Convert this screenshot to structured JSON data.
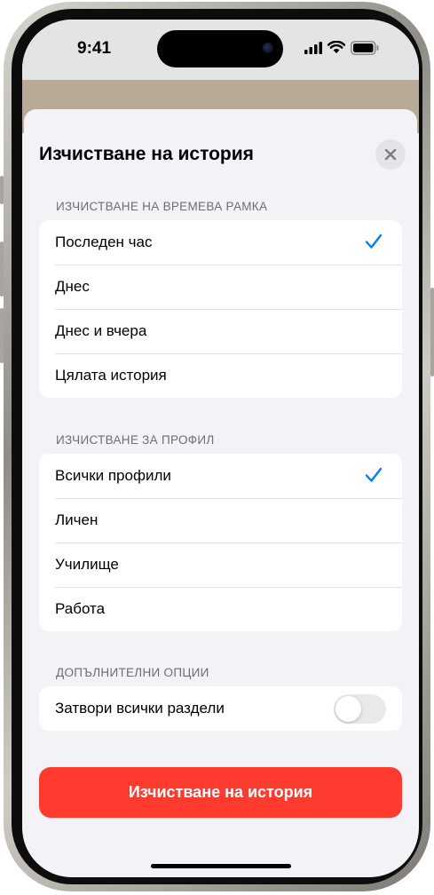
{
  "status_bar": {
    "time": "9:41"
  },
  "sheet": {
    "title": "Изчистване на история",
    "sections": [
      {
        "header": "ИЗЧИСТВАНЕ НА ВРЕМЕВА РАМКА",
        "items": [
          {
            "label": "Последен час",
            "selected": true
          },
          {
            "label": "Днес",
            "selected": false
          },
          {
            "label": "Днес и вчера",
            "selected": false
          },
          {
            "label": "Цялата история",
            "selected": false
          }
        ]
      },
      {
        "header": "ИЗЧИСТВАНЕ ЗА ПРОФИЛ",
        "items": [
          {
            "label": "Всички профили",
            "selected": true
          },
          {
            "label": "Личен",
            "selected": false
          },
          {
            "label": "Училище",
            "selected": false
          },
          {
            "label": "Работа",
            "selected": false
          }
        ]
      },
      {
        "header": "ДОПЪЛНИТЕЛНИ ОПЦИИ",
        "items": [
          {
            "label": "Затвори всички раздели",
            "toggle": false
          }
        ]
      }
    ],
    "primary_action": "Изчистване на история"
  },
  "colors": {
    "accent": "#007aff",
    "destructive": "#ff3b30",
    "background": "#f2f2f7"
  }
}
